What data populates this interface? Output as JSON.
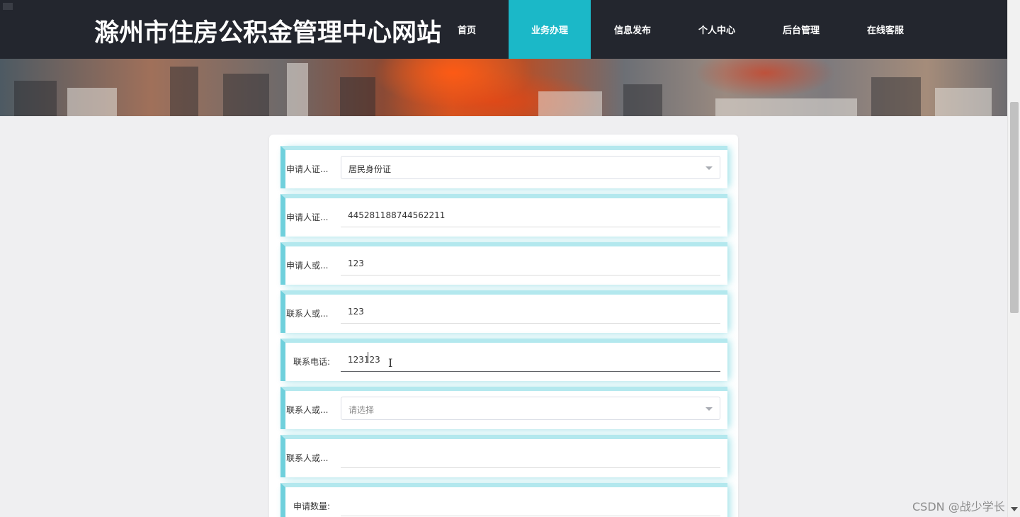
{
  "header": {
    "site_title": "滁州市住房公积金管理中心网站",
    "nav": [
      {
        "label": "首页",
        "active": false
      },
      {
        "label": "业务办理",
        "active": true
      },
      {
        "label": "信息发布",
        "active": false
      },
      {
        "label": "个人中心",
        "active": false
      },
      {
        "label": "后台管理",
        "active": false
      },
      {
        "label": "在线客服",
        "active": false
      }
    ]
  },
  "form": {
    "rows": [
      {
        "label": "申请人证...",
        "type": "select",
        "value": "居民身份证",
        "placeholder": ""
      },
      {
        "label": "申请人证...",
        "type": "input",
        "value": "445281188744562211",
        "placeholder": ""
      },
      {
        "label": "申请人或...",
        "type": "input",
        "value": "123",
        "placeholder": ""
      },
      {
        "label": "联系人或...",
        "type": "input",
        "value": "123",
        "placeholder": ""
      },
      {
        "label": "联系电话:",
        "type": "input",
        "value": "123123",
        "placeholder": ""
      },
      {
        "label": "联系人或...",
        "type": "select",
        "value": "",
        "placeholder": "请选择"
      },
      {
        "label": "联系人或...",
        "type": "input",
        "value": "",
        "placeholder": ""
      },
      {
        "label": "申请数量:",
        "type": "input",
        "value": "",
        "placeholder": ""
      }
    ]
  },
  "watermark": "CSDN @战少学长",
  "colors": {
    "topbar": "#23262e",
    "accent": "#1bb8c8",
    "page_bg": "#efeff1"
  }
}
